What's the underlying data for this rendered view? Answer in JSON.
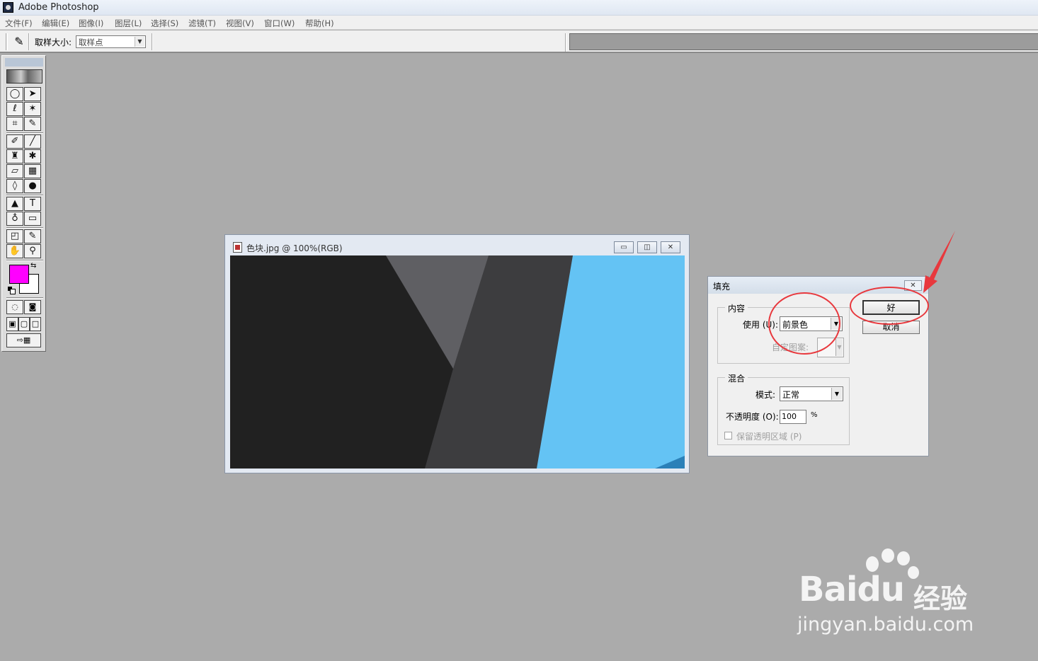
{
  "app": {
    "title": "Adobe Photoshop"
  },
  "menubar": {
    "items": [
      "文件(F)",
      "编辑(E)",
      "图像(I)",
      "图层(L)",
      "选择(S)",
      "滤镜(T)",
      "视图(V)",
      "窗口(W)",
      "帮助(H)"
    ]
  },
  "options_bar": {
    "tool_icon": "eyedropper-icon",
    "sample_size_label": "取样大小:",
    "sample_size_value": "取样点"
  },
  "toolbox": {
    "foreground_color": "#ff00ff",
    "background_color": "#ffffff"
  },
  "document": {
    "title": "色块.jpg @ 100%(RGB)",
    "canvas_colors": [
      "#212121",
      "#5f5f63",
      "#3d3d3f",
      "#64c3f4"
    ]
  },
  "fill_dialog": {
    "title": "填充",
    "contents_group": "内容",
    "use_label": "使用 (U):",
    "use_value": "前景色",
    "custom_pattern_label": "自定图案:",
    "blending_group": "混合",
    "mode_label": "模式:",
    "mode_value": "正常",
    "opacity_label": "不透明度 (O):",
    "opacity_value": "100",
    "opacity_unit": "%",
    "preserve_label": "保留透明区域 (P)",
    "ok_label": "好",
    "cancel_label": "取消"
  },
  "annotations": {
    "color": "#e8383d"
  },
  "watermark": {
    "brand": "Bai",
    "brand_suffix": "du",
    "product": "经验",
    "url": "jingyan.baidu.com"
  }
}
